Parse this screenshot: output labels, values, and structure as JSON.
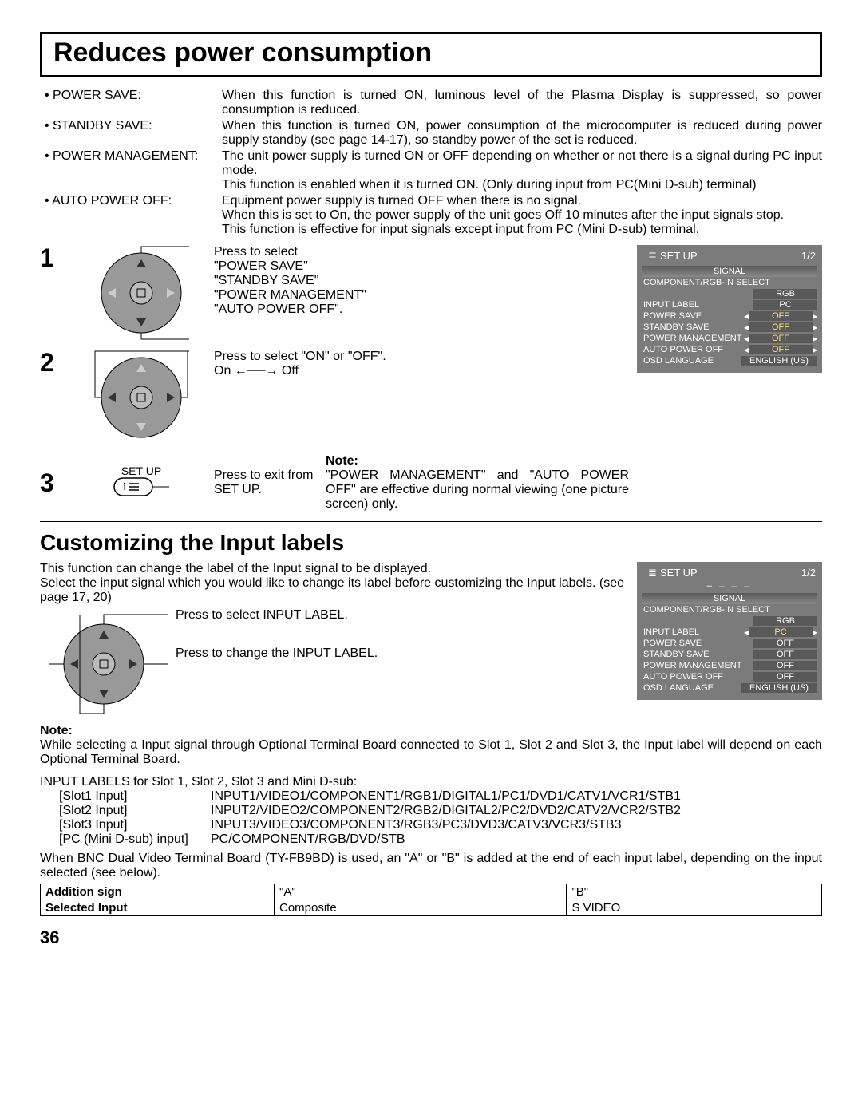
{
  "page_number": "36",
  "section1": {
    "title": "Reduces power consumption",
    "items": [
      {
        "label": "• POWER SAVE:",
        "text": "When this function is turned ON, luminous level of the Plasma Display is suppressed, so power consumption is reduced."
      },
      {
        "label": "• STANDBY SAVE:",
        "text": "When this function is turned ON, power consumption of the microcomputer is reduced during power supply standby (see page 14-17), so standby power of the set is reduced."
      },
      {
        "label": "• POWER MANAGEMENT:",
        "text": "The unit power supply is turned ON or OFF depending on whether or not there is a signal during PC input mode.",
        "text2": "This function is enabled when it is turned ON. (Only during input from PC(Mini D-sub) terminal)"
      },
      {
        "label": "• AUTO POWER OFF:",
        "text": "Equipment power supply is turned OFF when there is no signal.",
        "text2": "When this is set to On, the power supply of the unit goes Off 10 minutes after the input signals stop.",
        "text3": "This function is effective for input signals except input from PC (Mini D-sub) terminal."
      }
    ],
    "steps": {
      "s1": {
        "num": "1",
        "line1": "Press to select",
        "line2": "\"POWER SAVE\"",
        "line3": "\"STANDBY SAVE\"",
        "line4": "\"POWER MANAGEMENT\"",
        "line5": "\"AUTO POWER OFF\"."
      },
      "s2": {
        "num": "2",
        "line1": "Press to select \"ON\" or \"OFF\".",
        "line2": "On ←──→ Off"
      },
      "s3": {
        "num": "3",
        "btn_label": "SET UP",
        "line1": "Press to exit from SET UP."
      }
    },
    "note_title": "Note:",
    "note_text": "\"POWER MANAGEMENT\" and \"AUTO POWER OFF\" are effective during normal viewing (one picture screen) only."
  },
  "osd1": {
    "title": "SET UP",
    "page": "1/2",
    "signal": "SIGNAL",
    "row1": "COMPONENT/RGB-IN SELECT",
    "row1v": "RGB",
    "row2": "INPUT LABEL",
    "row2v": "PC",
    "row3": "POWER SAVE",
    "row3v": "OFF",
    "row4": "STANDBY SAVE",
    "row4v": "OFF",
    "row5": "POWER MANAGEMENT",
    "row5v": "OFF",
    "row6": "AUTO POWER OFF",
    "row6v": "OFF",
    "row7": "OSD LANGUAGE",
    "row7v": "ENGLISH (US)"
  },
  "section2": {
    "title": "Customizing the Input labels",
    "intro1": "This function can change the label of the Input signal to be displayed.",
    "intro2": "Select the input signal which you would like to change its label before customizing the Input labels. (see page 17, 20)",
    "step1": "Press to select INPUT LABEL.",
    "step2": "Press to change the INPUT LABEL.",
    "note_title": "Note:",
    "note_text": "While selecting a Input signal through Optional Terminal Board connected to Slot 1, Slot 2 and Slot 3, the Input label will depend on each Optional Terminal Board.",
    "labels_head": "INPUT LABELS for Slot 1, Slot 2, Slot 3 and Mini D-sub:",
    "labels": [
      {
        "k": "[Slot1 Input]",
        "v": "INPUT1/VIDEO1/COMPONENT1/RGB1/DIGITAL1/PC1/DVD1/CATV1/VCR1/STB1"
      },
      {
        "k": "[Slot2 Input]",
        "v": "INPUT2/VIDEO2/COMPONENT2/RGB2/DIGITAL2/PC2/DVD2/CATV2/VCR2/STB2"
      },
      {
        "k": "[Slot3 Input]",
        "v": "INPUT3/VIDEO3/COMPONENT3/RGB3/PC3/DVD3/CATV3/VCR3/STB3"
      },
      {
        "k": "[PC (Mini D-sub) input]",
        "v": "PC/COMPONENT/RGB/DVD/STB"
      }
    ],
    "bnc_text": "When BNC Dual Video Terminal Board (TY-FB9BD) is used, an \"A\" or \"B\" is added at the end of each input label, depending on the input selected (see below).",
    "table": {
      "r1c1": "Addition sign",
      "r1c2": "\"A\"",
      "r1c3": "\"B\"",
      "r2c1": "Selected Input",
      "r2c2": "Composite",
      "r2c3": "S VIDEO"
    }
  },
  "osd2": {
    "title": "SET UP",
    "page": "1/2",
    "signal": "SIGNAL",
    "row1": "COMPONENT/RGB-IN SELECT",
    "row1v": "RGB",
    "row2": "INPUT LABEL",
    "row2v": "PC",
    "row3": "POWER SAVE",
    "row3v": "OFF",
    "row4": "STANDBY SAVE",
    "row4v": "OFF",
    "row5": "POWER MANAGEMENT",
    "row5v": "OFF",
    "row6": "AUTO POWER OFF",
    "row6v": "OFF",
    "row7": "OSD LANGUAGE",
    "row7v": "ENGLISH (US)"
  }
}
